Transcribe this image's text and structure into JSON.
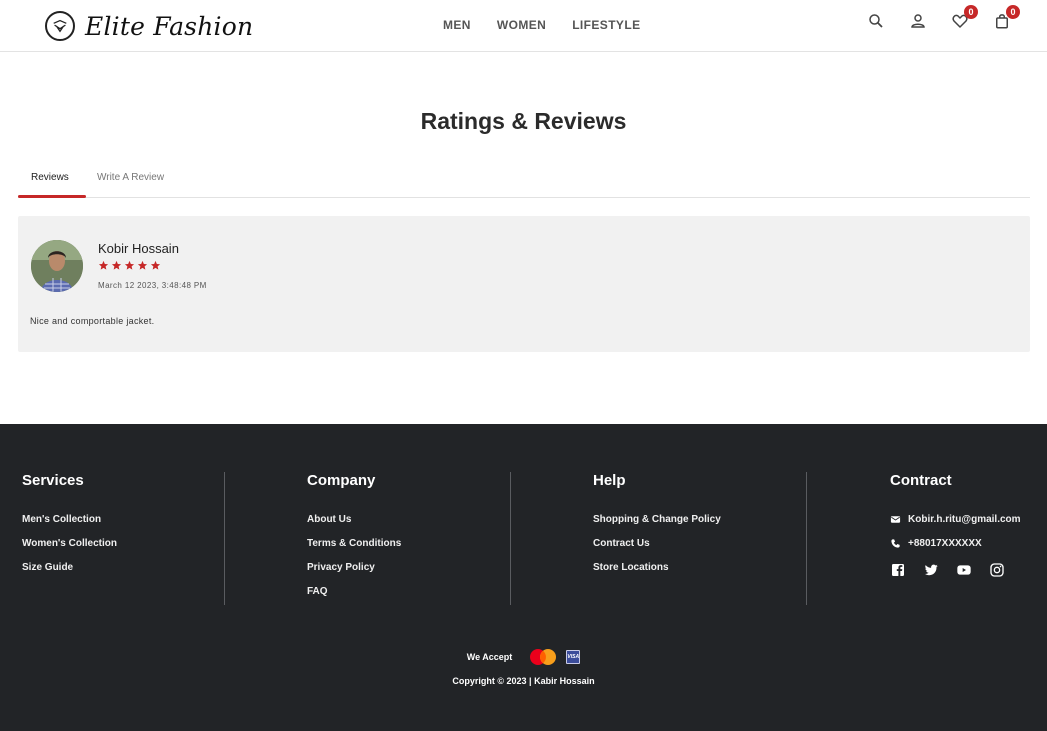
{
  "header": {
    "brand": "Elite Fashion",
    "nav": [
      "MEN",
      "WOMEN",
      "LIFESTYLE"
    ],
    "wishlist_count": "0",
    "cart_count": "0",
    "icons": [
      "search-icon",
      "user-icon",
      "heart-icon",
      "bag-icon"
    ]
  },
  "ratings": {
    "title": "Ratings & Reviews",
    "tabs": [
      "Reviews",
      "Write A Review"
    ],
    "active_tab": "Reviews",
    "review": {
      "name": "Kobir Hossain",
      "rating": 5,
      "date": "March 12 2023, 3:48:48 PM",
      "text": "Nice and comportable jacket."
    }
  },
  "footer": {
    "services": {
      "title": "Services",
      "links": [
        "Men's Collection",
        "Women's Collection",
        "Size Guide"
      ]
    },
    "company": {
      "title": "Company",
      "links": [
        "About Us",
        "Terms & Conditions",
        "Privacy Policy",
        "FAQ"
      ]
    },
    "help": {
      "title": "Help",
      "links": [
        "Shopping & Change Policy",
        "Contract Us",
        "Store Locations"
      ]
    },
    "contract": {
      "title": "Contract",
      "email": "Kobir.h.ritu@gmail.com",
      "phone": "+88017XXXXXX",
      "socials": [
        "facebook-icon",
        "twitter-icon",
        "youtube-icon",
        "instagram-icon"
      ]
    },
    "we_accept": "We Accept",
    "payment_methods": [
      "mastercard-icon",
      "visa-icon"
    ],
    "copyright": "Copyright © 2023 | Kabir Hossain"
  },
  "colors": {
    "accent": "#c62828",
    "footer_bg": "#222427",
    "card_bg": "#f1f1f1"
  }
}
